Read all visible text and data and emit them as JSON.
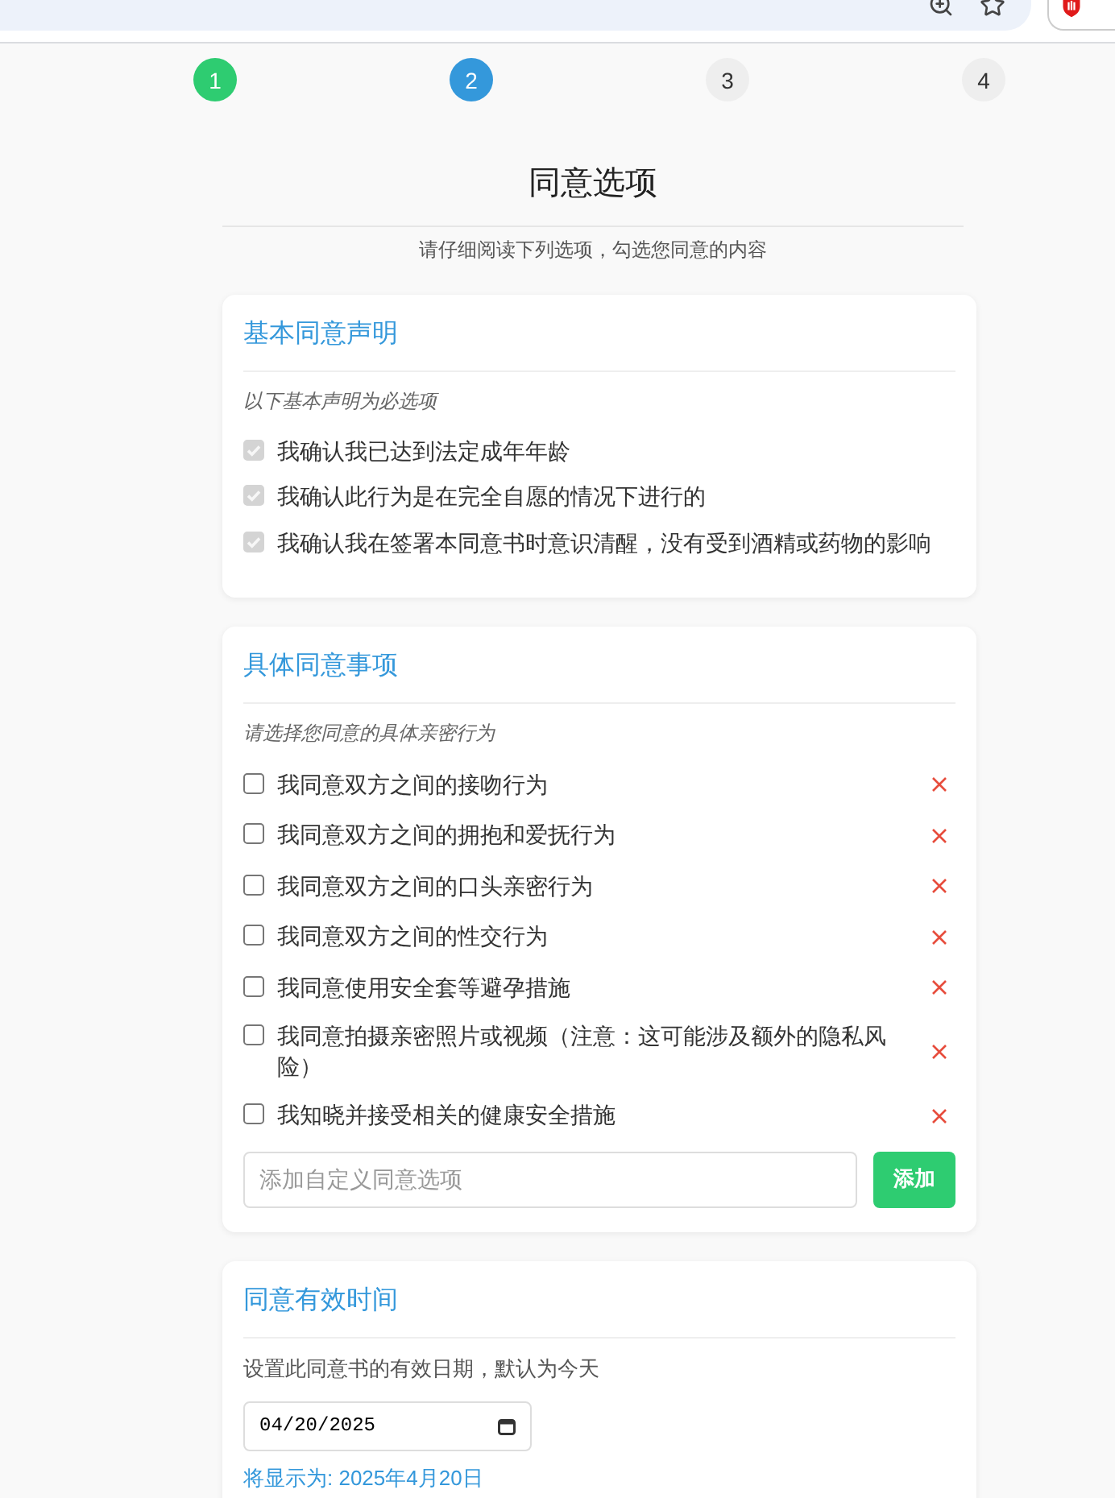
{
  "steps": [
    {
      "label": "1",
      "completed": true,
      "selected": false
    },
    {
      "label": "2",
      "completed": false,
      "selected": true
    },
    {
      "label": "3",
      "completed": false,
      "selected": false
    },
    {
      "label": "4",
      "completed": false,
      "selected": false
    }
  ],
  "page": {
    "title": "同意选项",
    "subtitle": "请仔细阅读下列选项，勾选您同意的内容"
  },
  "sections": [
    {
      "kind": "checklist",
      "title": "基本同意声明",
      "note": "以下基本声明为必选项",
      "items": [
        {
          "label": "我确认我已达到法定成年年龄",
          "checked": true,
          "disabled": true,
          "removable": false
        },
        {
          "label": "我确认此行为是在完全自愿的情况下进行的",
          "checked": true,
          "disabled": true,
          "removable": false
        },
        {
          "label": "我确认我在签署本同意书时意识清醒，没有受到酒精或药物的影响",
          "checked": true,
          "disabled": true,
          "removable": false
        }
      ]
    },
    {
      "kind": "checklist",
      "title": "具体同意事项",
      "note": "请选择您同意的具体亲密行为",
      "items": [
        {
          "label": "我同意双方之间的接吻行为",
          "checked": false,
          "disabled": false,
          "removable": true
        },
        {
          "label": "我同意双方之间的拥抱和爱抚行为",
          "checked": false,
          "disabled": false,
          "removable": true
        },
        {
          "label": "我同意双方之间的口头亲密行为",
          "checked": false,
          "disabled": false,
          "removable": true
        },
        {
          "label": "我同意双方之间的性交行为",
          "checked": false,
          "disabled": false,
          "removable": true
        },
        {
          "label": "我同意使用安全套等避孕措施",
          "checked": false,
          "disabled": false,
          "removable": true
        },
        {
          "label": "我同意拍摄亲密照片或视频（注意：这可能涉及额外的隐私风险）",
          "checked": false,
          "disabled": false,
          "removable": true
        },
        {
          "label": "我知晓并接受相关的健康安全措施",
          "checked": false,
          "disabled": false,
          "removable": true
        }
      ],
      "add_field": {
        "placeholder": "添加自定义同意选项"
      },
      "add_button": "添加"
    },
    {
      "kind": "date",
      "title": "同意有效时间",
      "description": "设置此同意书的有效日期，默认为今天",
      "date_field": {
        "value": "04/20/2025"
      },
      "preview": "将显示为: 2025年4月20日"
    }
  ]
}
